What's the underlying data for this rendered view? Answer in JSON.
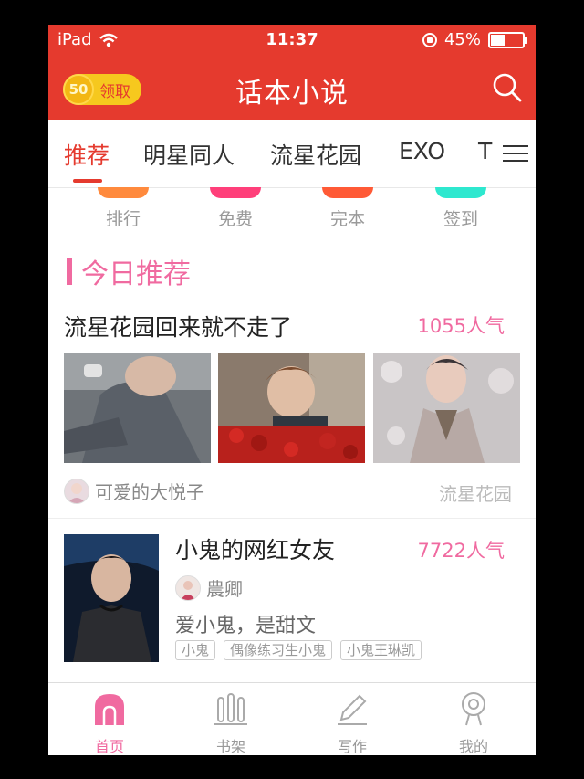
{
  "status_bar": {
    "carrier": "iPad",
    "time": "11:37",
    "battery": "45%",
    "battery_level": 0.45
  },
  "header": {
    "coin_count": "50",
    "claim_label": "领取",
    "title": "话本小说",
    "search_icon": "search-icon"
  },
  "tabs": [
    {
      "label": "推荐",
      "active": true
    },
    {
      "label": "明星同人"
    },
    {
      "label": "流星花园"
    },
    {
      "label": "EXO"
    },
    {
      "label": "TI"
    }
  ],
  "quick_links": [
    {
      "label": "排行",
      "color": "#ff8a3d"
    },
    {
      "label": "免费",
      "color": "#ff3f7a"
    },
    {
      "label": "完本",
      "color": "#ff5a36"
    },
    {
      "label": "签到",
      "color": "#2ee8cf"
    }
  ],
  "section": {
    "title": "今日推荐"
  },
  "featured": {
    "title": "流星花园回来就不走了",
    "popularity": "1055人气",
    "author": "可爱的大悦子",
    "category": "流星花园"
  },
  "books": [
    {
      "title": "小鬼的网红女友",
      "popularity": "7722人气",
      "author": "農卿",
      "description": "爱小鬼，是甜文",
      "tags": [
        "小鬼",
        "偶像练习生小鬼",
        "小鬼王琳凯"
      ]
    }
  ],
  "bottom_nav": [
    {
      "label": "首页",
      "icon": "home-icon",
      "active": true
    },
    {
      "label": "书架",
      "icon": "bookshelf-icon"
    },
    {
      "label": "写作",
      "icon": "pencil-icon"
    },
    {
      "label": "我的",
      "icon": "profile-icon"
    }
  ],
  "colors": {
    "brand_red": "#e53a2e",
    "accent_pink": "#f06aa0",
    "coin_yellow": "#f6c81e"
  }
}
